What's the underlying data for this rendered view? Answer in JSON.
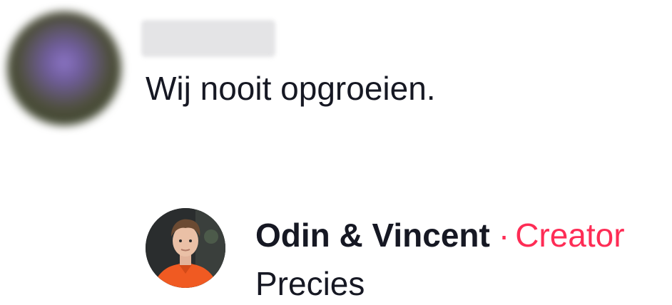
{
  "comment": {
    "text": "Wij nooit opgroeien."
  },
  "reply": {
    "author": "Odin & Vincent",
    "separator": "·",
    "badge": "Creator",
    "text": "Precies"
  },
  "colors": {
    "text": "#161823",
    "accent": "#fe2c55"
  }
}
